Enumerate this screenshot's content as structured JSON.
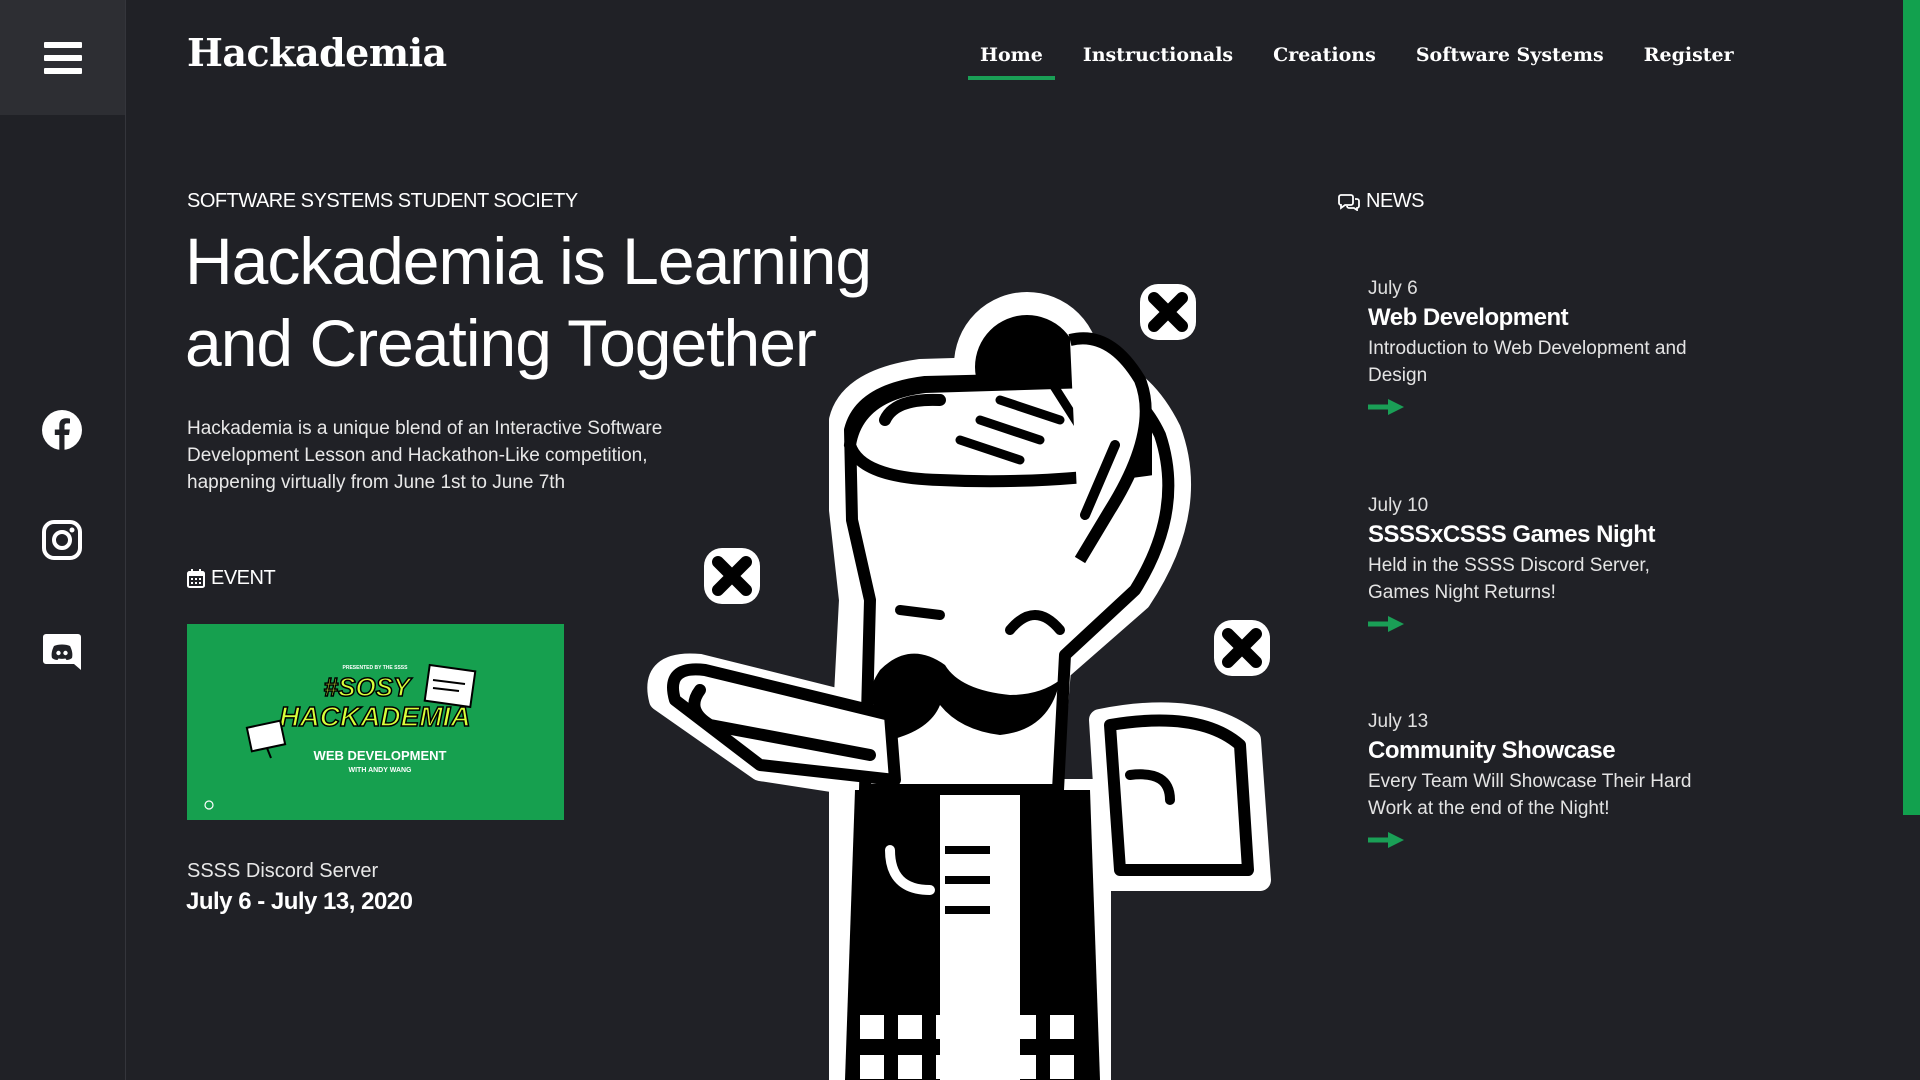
{
  "brand": "Hackademia",
  "nav": {
    "items": [
      {
        "label": "Home",
        "active": true
      },
      {
        "label": "Instructionals"
      },
      {
        "label": "Creations"
      },
      {
        "label": "Software Systems"
      },
      {
        "label": "Register"
      }
    ]
  },
  "sidebar": {
    "menu_icon": "hamburger-icon",
    "socials": [
      "facebook-icon",
      "instagram-icon",
      "discord-icon"
    ]
  },
  "hero": {
    "kicker": "SOFTWARE SYSTEMS STUDENT SOCIETY",
    "title_line1": "Hackademia is Learning",
    "title_line2": "and Creating Together",
    "description": "Hackademia is a unique blend of an Interactive Software Development Lesson and Hackathon-Like competition, happening virtually from June 1st to June 7th"
  },
  "event": {
    "heading": "EVENT",
    "heading_icon": "calendar-icon",
    "banner": {
      "presented": "PRESENTED BY THE SSSS",
      "tag1": "#SOSY",
      "tag2": "HACKADEMIA",
      "subtitle": "WEB DEVELOPMENT",
      "with": "WITH ANDY WANG"
    },
    "location": "SSSS Discord Server",
    "date": "July 6 - July 13, 2020"
  },
  "news": {
    "heading": "NEWS",
    "heading_icon": "comments-icon",
    "items": [
      {
        "date": "July 6",
        "title": "Web Development",
        "description": "Introduction to Web Development and Design"
      },
      {
        "date": "July 10",
        "title": "SSSSxCSSS Games Night",
        "description": "Held in the SSSS Discord Server, Games Night Returns!"
      },
      {
        "date": "July 13",
        "title": "Community Showcase",
        "description": "Every Team Will Showcase Their Hard Work at the end of the Night!"
      }
    ]
  },
  "colors": {
    "background": "#202126",
    "accent": "#1a9f56",
    "scroll_accent": "#12a14e"
  }
}
